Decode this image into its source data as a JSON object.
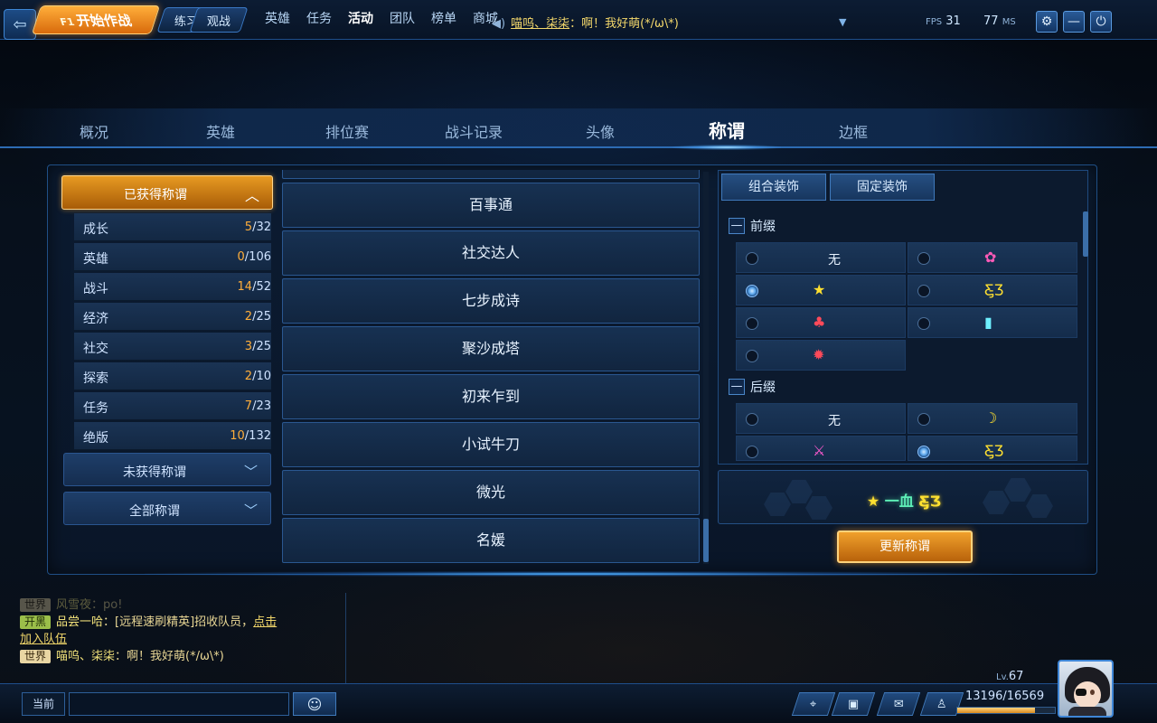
{
  "topbar": {
    "back_icon": "back-arrow-icon",
    "start_key": "F1",
    "start_label": "开始作战",
    "practice_label": "练习",
    "spectate_label": "观战",
    "nav": [
      {
        "label": "英雄",
        "active": false
      },
      {
        "label": "任务",
        "active": false
      },
      {
        "label": "活动",
        "active": true
      },
      {
        "label": "团队",
        "active": false
      },
      {
        "label": "榜单",
        "active": false
      },
      {
        "label": "商城",
        "active": false
      }
    ],
    "broadcast": {
      "name": "喵呜、柒柒",
      "message": "：啊！我好萌(*/ω\\*)"
    },
    "fps_label": "FPS",
    "fps_value": "31",
    "ping_value": "77",
    "ping_unit": "MS",
    "icons": [
      "settings-icon",
      "minimize-icon",
      "power-icon"
    ]
  },
  "tabs": [
    {
      "label": "概况",
      "active": false
    },
    {
      "label": "英雄",
      "active": false
    },
    {
      "label": "排位赛",
      "active": false
    },
    {
      "label": "战斗记录",
      "active": false
    },
    {
      "label": "头像",
      "active": false
    },
    {
      "label": "称谓",
      "active": true
    },
    {
      "label": "边框",
      "active": false
    }
  ],
  "categories": {
    "obtained_label": "已获得称谓",
    "rows": [
      {
        "name": "成长",
        "got": "5",
        "total": "/32"
      },
      {
        "name": "英雄",
        "got": "0",
        "total": "/106"
      },
      {
        "name": "战斗",
        "got": "14",
        "total": "/52"
      },
      {
        "name": "经济",
        "got": "2",
        "total": "/25"
      },
      {
        "name": "社交",
        "got": "3",
        "total": "/25"
      },
      {
        "name": "探索",
        "got": "2",
        "total": "/10"
      },
      {
        "name": "任务",
        "got": "7",
        "total": "/23"
      },
      {
        "name": "绝版",
        "got": "10",
        "total": "/132"
      }
    ],
    "unobtained_label": "未获得称谓",
    "all_label": "全部称谓"
  },
  "titles": [
    "百事通",
    "社交达人",
    "七步成诗",
    "聚沙成塔",
    "初来乍到",
    "小试牛刀",
    "微光",
    "名媛"
  ],
  "decoration": {
    "tab_combo": "组合装饰",
    "tab_fixed": "固定装饰",
    "prefix_label": "前缀",
    "suffix_label": "后缀",
    "collapse_symbol": "—",
    "none_label": "无",
    "prefix_options": [
      {
        "icon": "",
        "text": "无",
        "selected": false
      },
      {
        "icon": "pink-flower-icon",
        "text": "",
        "selected": false
      },
      {
        "icon": "star-icon",
        "text": "",
        "selected": true
      },
      {
        "icon": "butterfly-icon",
        "text": "",
        "selected": false
      },
      {
        "icon": "cherry-icon",
        "text": "",
        "selected": false
      },
      {
        "icon": "bottle-icon",
        "text": "",
        "selected": false
      },
      {
        "icon": "red-gear-icon",
        "text": "",
        "selected": false
      }
    ],
    "suffix_options": [
      {
        "icon": "",
        "text": "无",
        "selected": false
      },
      {
        "icon": "moon-icon",
        "text": "",
        "selected": false
      },
      {
        "icon": "crossed-swords-icon",
        "text": "",
        "selected": false
      },
      {
        "icon": "butterfly-icon",
        "text": "",
        "selected": true
      }
    ],
    "preview_text": "一血",
    "preview_prefix_icon": "star-icon",
    "preview_suffix_icon": "butterfly-icon",
    "update_label": "更新称谓"
  },
  "chat": {
    "lines": [
      {
        "channel": "世界",
        "name": "风雪夜",
        "text": "：po!"
      },
      {
        "channel": "开黑",
        "name": "品尝一哈",
        "text": "：[远程速刷精英]招收队员，",
        "link": "点击",
        "link2": "加入队伍"
      },
      {
        "channel": "世界",
        "name": "喵呜、柒柒",
        "text": "：啊！我好萌(*/ω\\*)"
      }
    ],
    "mode_label": "当前",
    "input_placeholder": "",
    "emoji_icon": "smiley-icon",
    "quick_icons": [
      "map-marker-icon",
      "gift-box-icon",
      "mail-icon",
      "friends-icon"
    ]
  },
  "player": {
    "level_label": "Lv.",
    "level": "67",
    "exp": "13196/16569",
    "exp_fraction": 0.796
  }
}
